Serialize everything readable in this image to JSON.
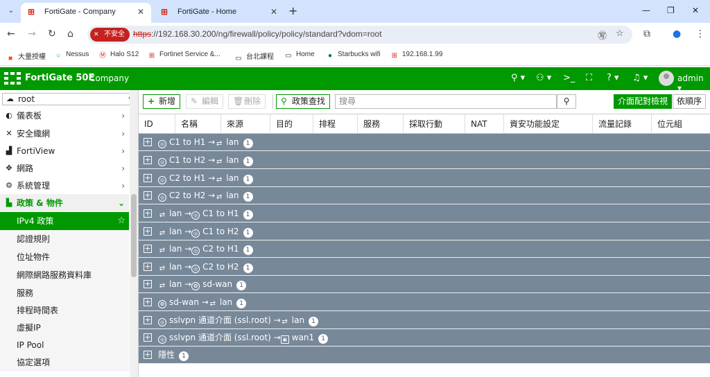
{
  "browser": {
    "tabs": [
      {
        "label": "FortiGate - Company",
        "active": true
      },
      {
        "label": "FortiGate - Home",
        "active": false
      }
    ],
    "url_scheme": "https",
    "url_rest": "://192.168.30.200/ng/firewall/policy/policy/standard?vdom=root",
    "insecure_label": "不安全",
    "bookmarks": [
      "大量授權",
      "Nessus",
      "Halo S12",
      "Fortinet Service &...",
      "台北課程",
      "Home",
      "Starbucks wifi",
      "192.168.1.99"
    ]
  },
  "app": {
    "product": "FortiGate 50E",
    "company": "Company",
    "user": "admin"
  },
  "sidebar": {
    "vdom": "root",
    "items": [
      {
        "label": "儀表板",
        "icon": "dashboard-icon"
      },
      {
        "label": "安全織網",
        "icon": "fabric-icon"
      },
      {
        "label": "FortiView",
        "icon": "chart-icon"
      },
      {
        "label": "網路",
        "icon": "network-icon"
      },
      {
        "label": "系統管理",
        "icon": "gear-icon"
      },
      {
        "label": "政策 & 物件",
        "icon": "policy-icon"
      }
    ],
    "subitems": [
      "IPv4 政策",
      "認證規則",
      "位址物件",
      "網際網路服務資料庫",
      "服務",
      "排程時間表",
      "虛擬IP",
      "IP Pool",
      "協定選項"
    ]
  },
  "toolbar": {
    "add": "新增",
    "edit": "編輯",
    "delete": "刪除",
    "find": "政策查找",
    "search_placeholder": "搜尋",
    "view_pair": "介面配對檢視",
    "view_seq": "依順序"
  },
  "table": {
    "columns": [
      "ID",
      "名稱",
      "來源",
      "目的",
      "排程",
      "服務",
      "採取行動",
      "NAT",
      "資安功能設定",
      "流量記錄",
      "位元組"
    ],
    "rows": [
      {
        "src": "C1 to H1",
        "dst": "lan",
        "count": "1"
      },
      {
        "src": "C1 to H2",
        "dst": "lan",
        "count": "1"
      },
      {
        "src": "C2 to H1",
        "dst": "lan",
        "count": "1"
      },
      {
        "src": "C2 to H2",
        "dst": "lan",
        "count": "1"
      },
      {
        "src": "lan",
        "dst": "C1 to H1",
        "count": "1"
      },
      {
        "src": "lan",
        "dst": "C1 to H2",
        "count": "1"
      },
      {
        "src": "lan",
        "dst": "C2 to H1",
        "count": "1"
      },
      {
        "src": "lan",
        "dst": "C2 to H2",
        "count": "1"
      },
      {
        "src": "lan",
        "dst": "sd-wan",
        "count": "1"
      },
      {
        "src": "sd-wan",
        "dst": "lan",
        "count": "1"
      },
      {
        "src": "sslvpn 通道介面 (ssl.root)",
        "dst": "lan",
        "count": "1"
      },
      {
        "src": "sslvpn 通道介面 (ssl.root)",
        "dst": "wan1",
        "count": "1"
      },
      {
        "src": "隱性",
        "dst": "",
        "count": "1"
      }
    ]
  }
}
